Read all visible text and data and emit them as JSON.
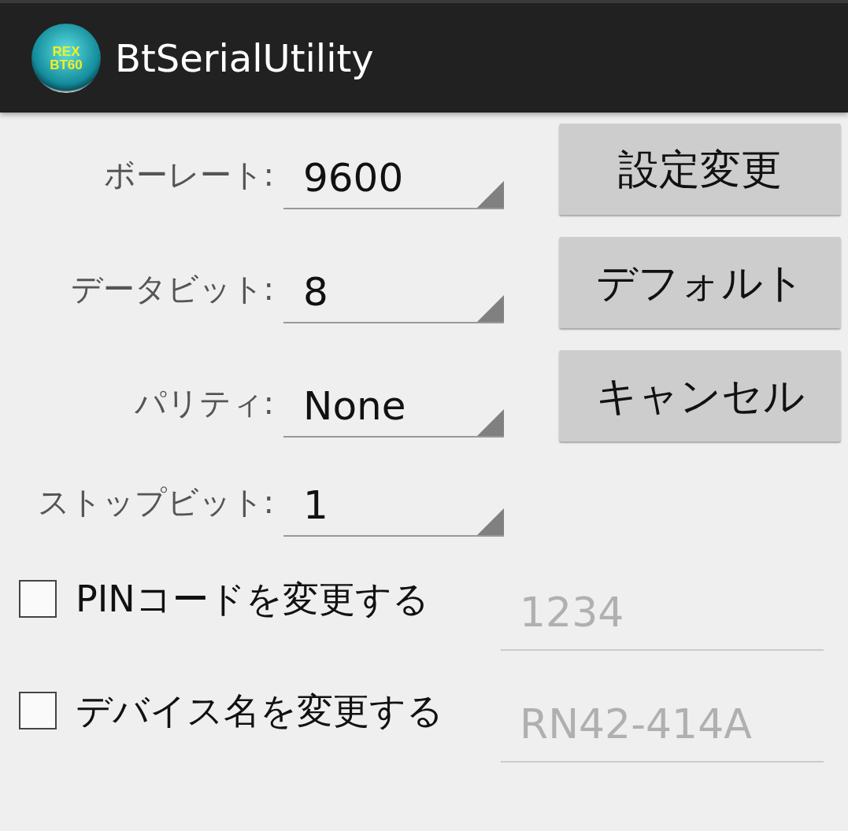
{
  "app_bar": {
    "logo_text": [
      "REX",
      "BT60"
    ],
    "title": "BtSerialUtility"
  },
  "settings": [
    {
      "label": "ボーレート:",
      "value": "9600"
    },
    {
      "label": "データビット:",
      "value": "8"
    },
    {
      "label": "パリティ:",
      "value": "None"
    },
    {
      "label": "ストップビット:",
      "value": "1"
    }
  ],
  "buttons": [
    "設定変更",
    "デフォルト",
    "キャンセル"
  ],
  "options": [
    {
      "label": "PINコードを変更する",
      "checked": false,
      "value": "1234",
      "disabled": true
    },
    {
      "label": "デバイス名を変更する",
      "checked": false,
      "value": "RN42-414A",
      "disabled": true
    }
  ]
}
